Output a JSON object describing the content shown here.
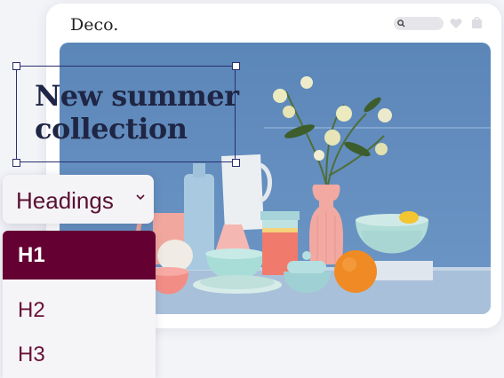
{
  "header": {
    "logo": "Deco."
  },
  "hero": {
    "headline_line1": "New summer",
    "headline_line2": "collection"
  },
  "dropdown": {
    "label": "Headings"
  },
  "menu": {
    "options": [
      "H1",
      "H2",
      "H3"
    ],
    "selected": "H1"
  },
  "colors": {
    "accent": "#650032",
    "headline": "#1f2544",
    "selection": "#2a2f6e"
  },
  "icons": [
    "search-icon",
    "heart-icon",
    "bag-icon",
    "chevron-down-icon"
  ]
}
